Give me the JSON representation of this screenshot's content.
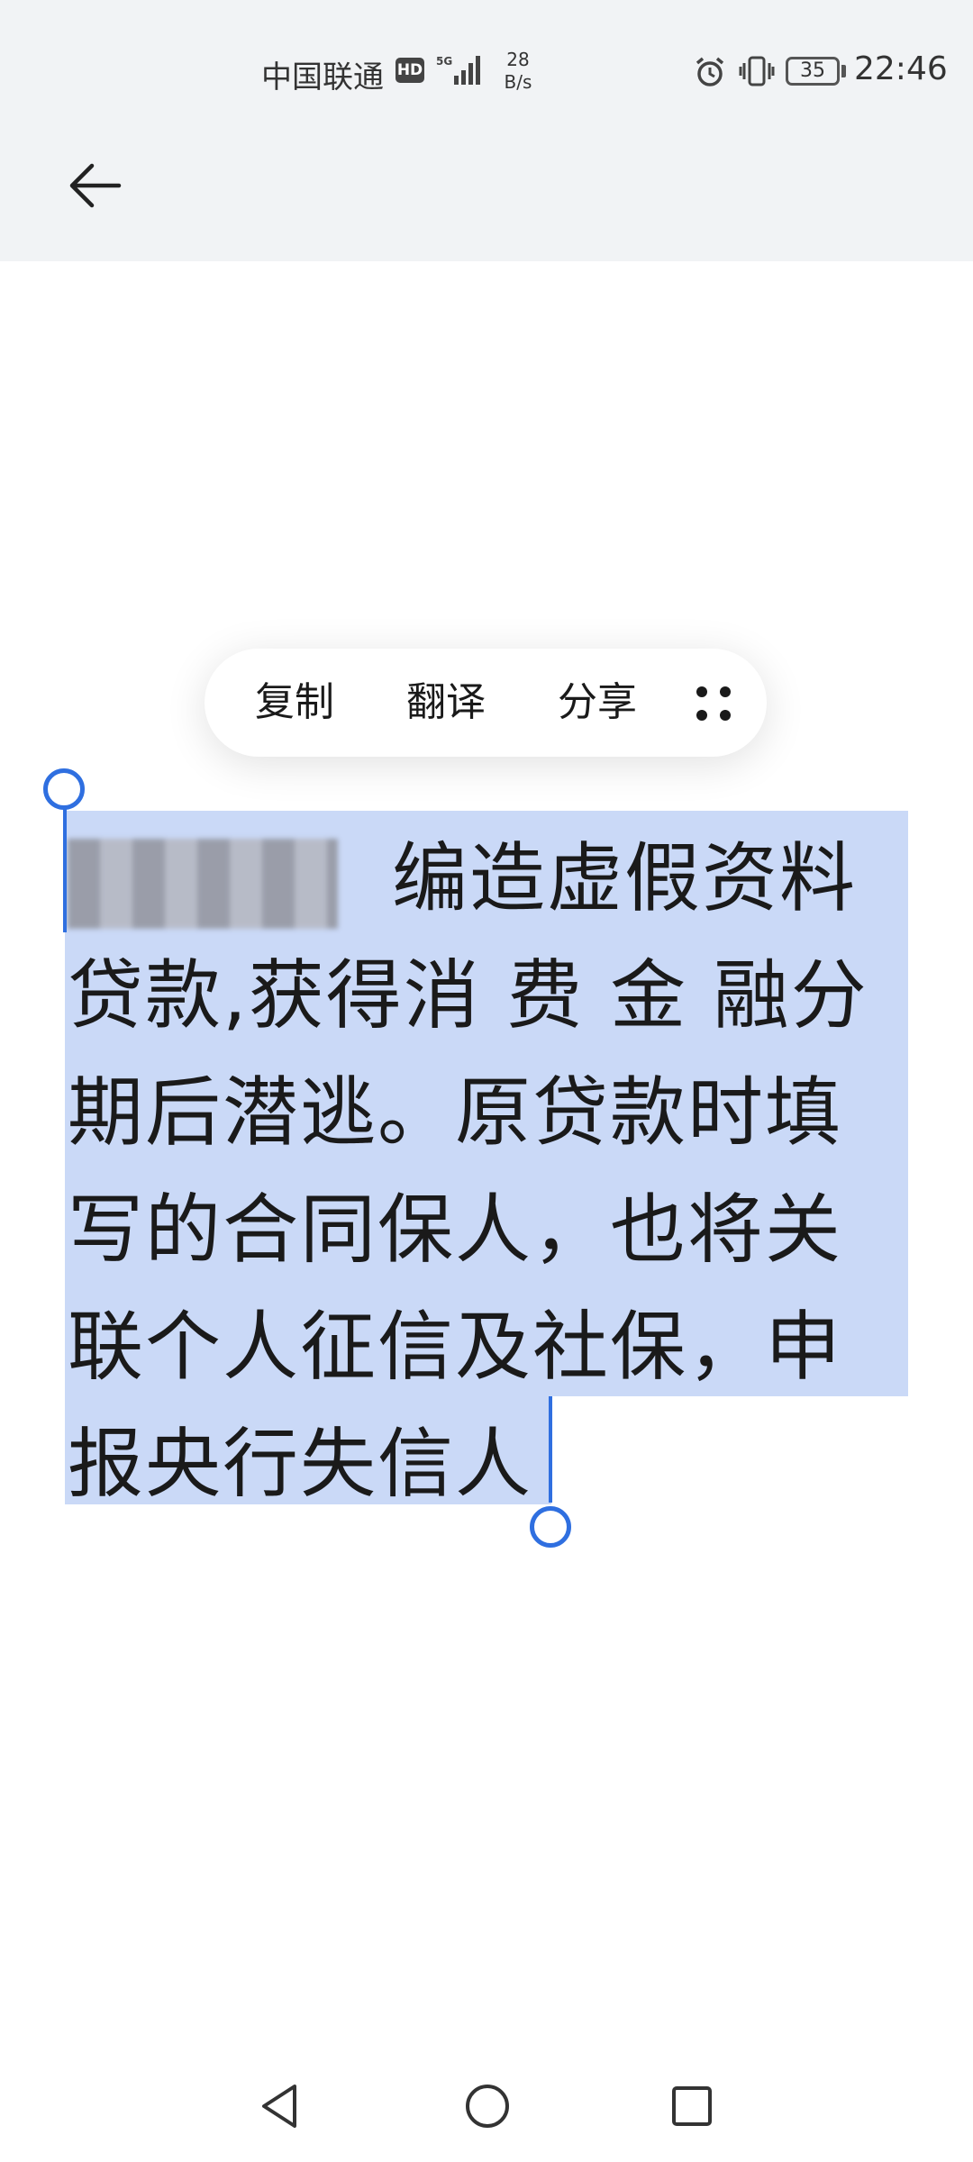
{
  "status_bar": {
    "carrier": "中国联通",
    "hd_badge": "HD",
    "network_type": "5G",
    "speed_value": "28",
    "speed_unit": "B/s",
    "battery_level": "35",
    "time": "22:46",
    "icons": [
      "alarm-icon",
      "vibrate-icon",
      "battery-icon",
      "signal-icon"
    ]
  },
  "header": {
    "back_icon": "arrow-left-icon"
  },
  "context_menu": {
    "items": [
      {
        "label": "复制"
      },
      {
        "label": "翻译"
      },
      {
        "label": "分享"
      }
    ],
    "more_icon": "more-dots-icon"
  },
  "content": {
    "selected_text_lines": [
      "编造虚假资料",
      "贷款,获得消 费 金 融分",
      "期后潜逃。原贷款时填",
      "写的合同保人，也将关",
      "联个人征信及社保，申",
      "报央行失信人"
    ]
  },
  "colors": {
    "selection": "#cad9f7",
    "handle": "#2f6fe0",
    "header_bg": "#f1f3f5"
  },
  "nav_bar": {
    "icons": [
      "nav-back-icon",
      "nav-home-icon",
      "nav-recents-icon"
    ]
  }
}
